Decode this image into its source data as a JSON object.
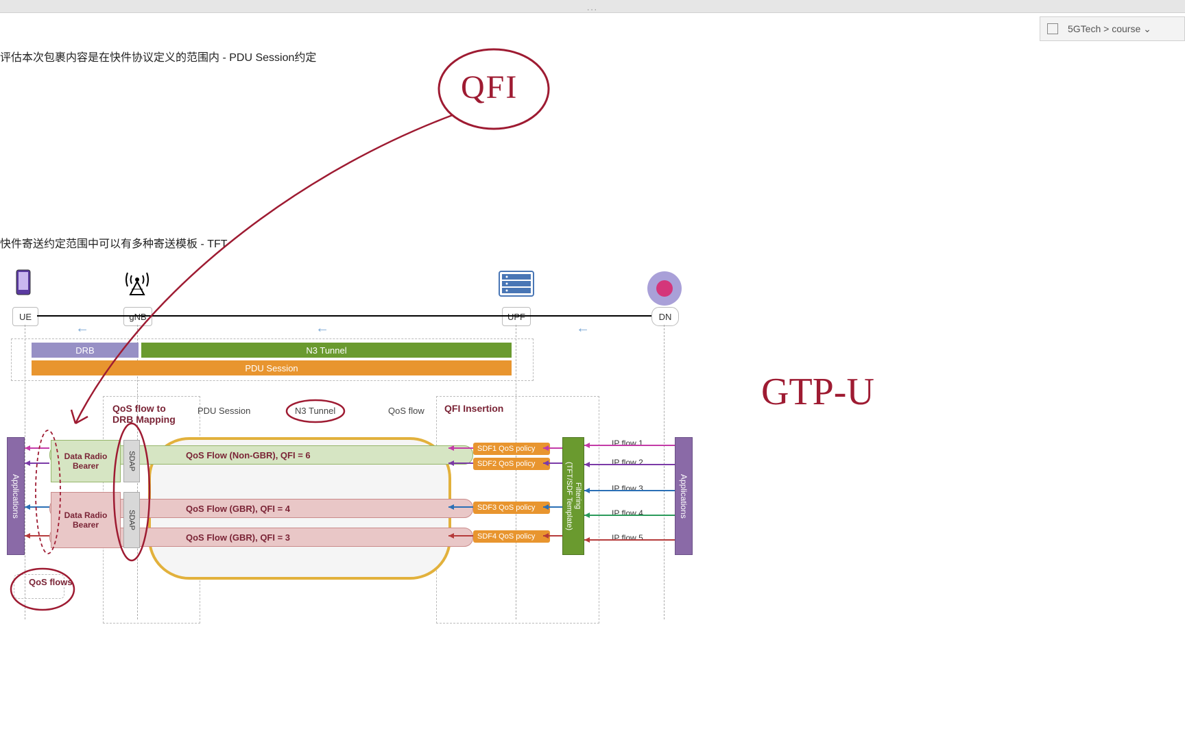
{
  "titlebar": {
    "dots": "..."
  },
  "breadcrumb": {
    "path": "5GTech > course  ⌄"
  },
  "headings": {
    "h1": "评估本次包裹内容是在快件协议定义的范围内 - PDU Session约定",
    "h2": "快件寄送约定范围中可以有多种寄送模板 - TFT"
  },
  "nodes": {
    "ue": "UE",
    "gnb": "gNB",
    "upf": "UPF",
    "dn": "DN"
  },
  "bars": {
    "drb": "DRB",
    "n3": "N3 Tunnel",
    "pdu": "PDU Session"
  },
  "labels": {
    "qos_flow_to_drb": "QoS flow to\nDRB Mapping",
    "pdu_session": "PDU Session",
    "n3_tunnel": "N3 Tunnel",
    "qos_flow": "QoS flow",
    "qfi_insertion": "QFI Insertion",
    "qos_flows_bottom": "QoS flows",
    "applications_left": "Applications",
    "applications_right": "Applications",
    "sdap": "SDAP",
    "filter": "Filtering\n(TFT/SDF Template)",
    "drb1": "Data Radio\nBearer",
    "drb2": "Data Radio\nBearer"
  },
  "qos_rows": {
    "r1": "QoS Flow (Non-GBR), QFI = 6",
    "r2": "QoS Flow (GBR), QFI = 4",
    "r3": "QoS Flow (GBR), QFI = 3"
  },
  "sdf": {
    "s1": "SDF1  QoS policy",
    "s2": "SDF2 QoS policy",
    "s3": "SDF3 QoS policy",
    "s4": "SDF4 QoS policy"
  },
  "ipflows": {
    "f1": "IP flow 1",
    "f2": "IP flow 2",
    "f3": "IP flow 3",
    "f4": "IP flow 4",
    "f5": "IP flow 5"
  },
  "annotations": {
    "qfi": "QFI",
    "gtpu": "GTP-U"
  }
}
